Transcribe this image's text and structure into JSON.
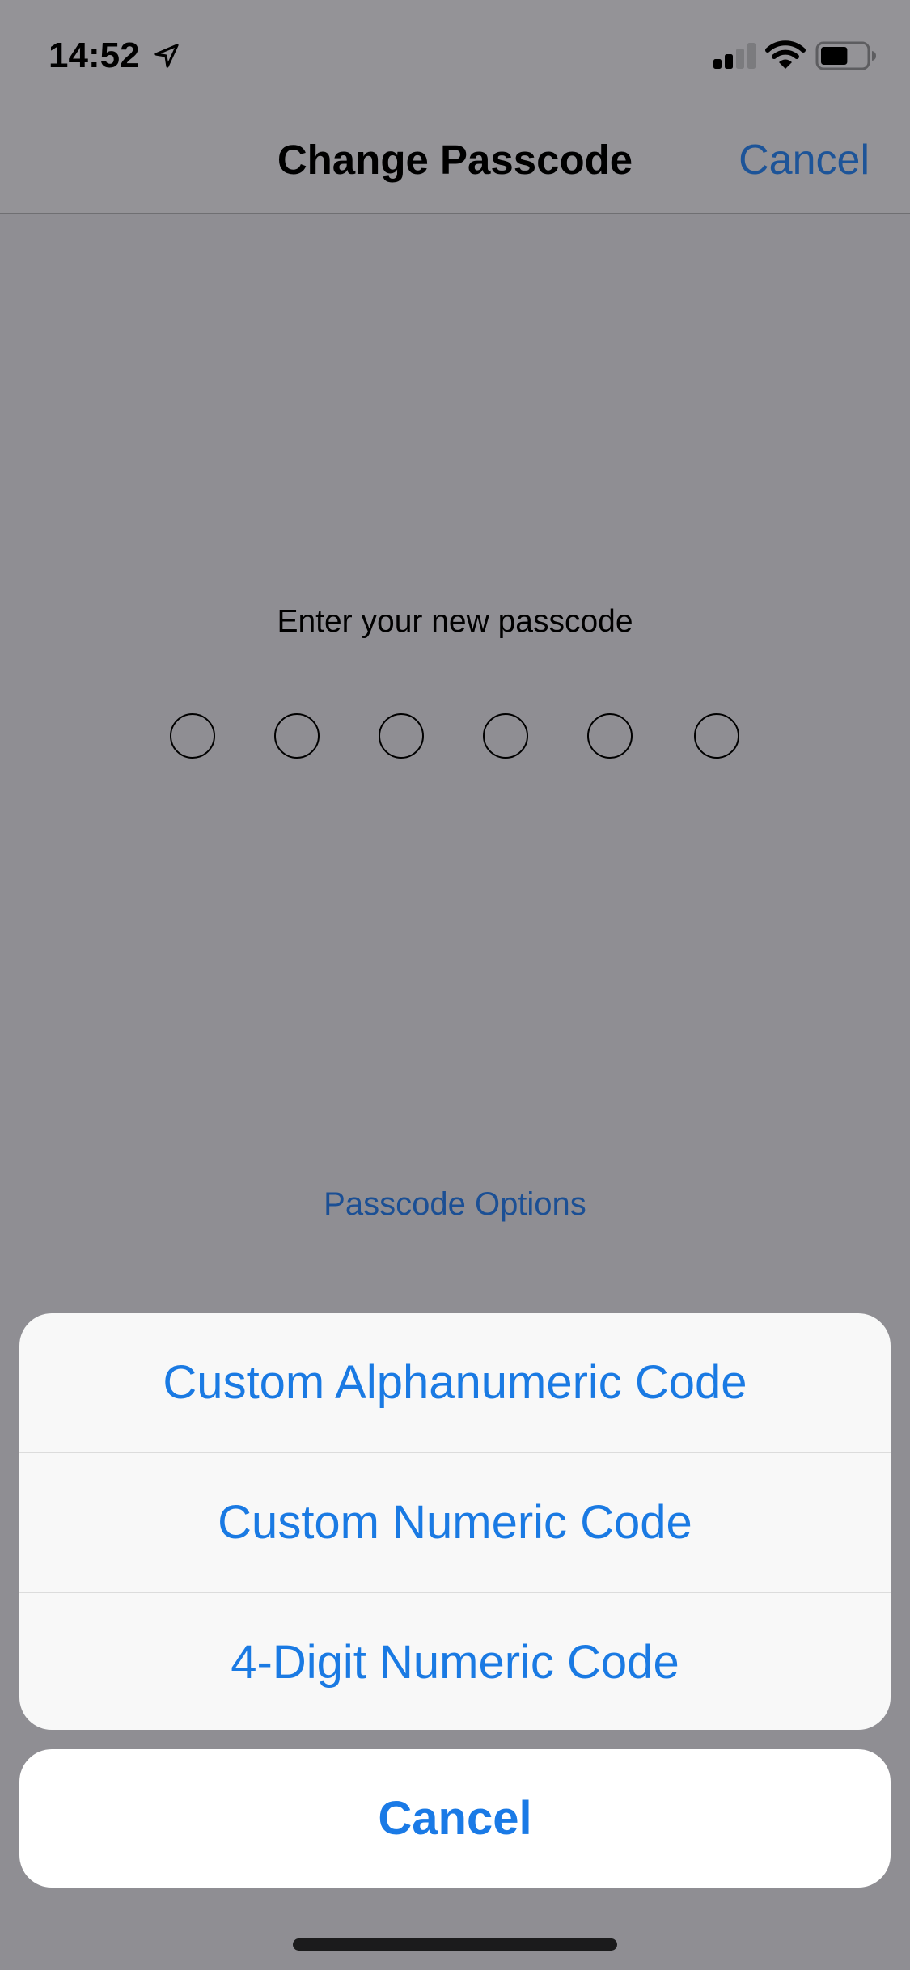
{
  "status_bar": {
    "time": "14:52",
    "location_icon": "location-arrow-icon",
    "signal_icon": "cellular-signal-icon",
    "signal_bars_active": 2,
    "signal_bars_total": 4,
    "wifi_icon": "wifi-icon",
    "battery_icon": "battery-icon",
    "battery_level_fraction": 0.6
  },
  "nav": {
    "title": "Change Passcode",
    "cancel_label": "Cancel"
  },
  "passcode": {
    "prompt": "Enter your new passcode",
    "digit_count": 6,
    "digits_entered": 0
  },
  "options_link": "Passcode Options",
  "action_sheet": {
    "items": [
      {
        "label": "Custom Alphanumeric Code"
      },
      {
        "label": "Custom Numeric Code"
      },
      {
        "label": "4-Digit Numeric Code"
      }
    ],
    "cancel_label": "Cancel"
  },
  "colors": {
    "accent": "#1a7ae3",
    "dimmed_accent": "#1d5498",
    "overlay_bg": "#8f8e93",
    "sheet_bg": "#f8f8f8"
  }
}
